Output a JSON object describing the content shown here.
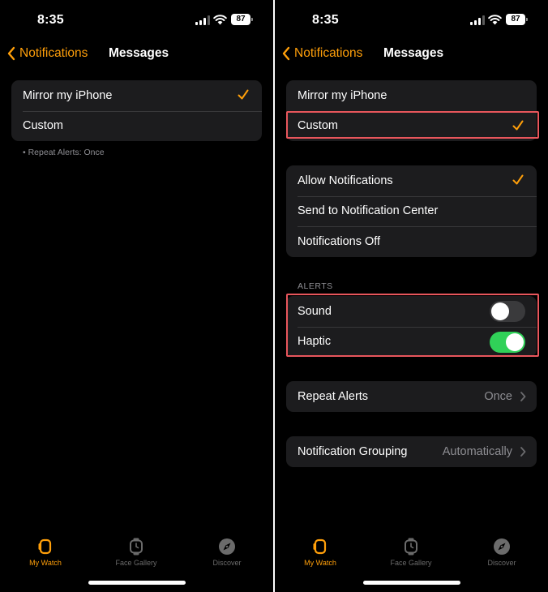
{
  "status_bar": {
    "time": "8:35",
    "battery": "87"
  },
  "nav": {
    "back_label": "Notifications",
    "title": "Messages"
  },
  "left": {
    "options": [
      {
        "label": "Mirror my iPhone",
        "selected": true
      },
      {
        "label": "Custom",
        "selected": false
      }
    ],
    "footnote": "• Repeat Alerts: Once"
  },
  "right": {
    "options": [
      {
        "label": "Mirror my iPhone",
        "selected": false
      },
      {
        "label": "Custom",
        "selected": true
      }
    ],
    "delivery": [
      {
        "label": "Allow Notifications",
        "selected": true
      },
      {
        "label": "Send to Notification Center",
        "selected": false
      },
      {
        "label": "Notifications Off",
        "selected": false
      }
    ],
    "alerts_header": "ALERTS",
    "alerts": [
      {
        "label": "Sound",
        "on": false
      },
      {
        "label": "Haptic",
        "on": true
      }
    ],
    "repeat_alerts": {
      "label": "Repeat Alerts",
      "value": "Once"
    },
    "grouping": {
      "label": "Notification Grouping",
      "value": "Automatically"
    }
  },
  "tab_bar": {
    "tabs": [
      {
        "label": "My Watch",
        "icon": "watch-icon",
        "active": true
      },
      {
        "label": "Face Gallery",
        "icon": "watch-face-icon",
        "active": false
      },
      {
        "label": "Discover",
        "icon": "compass-icon",
        "active": false
      }
    ]
  },
  "colors": {
    "accent": "#ff9f0a",
    "toggle_on": "#30d158",
    "highlight": "#e8565c",
    "background": "#000000",
    "cell": "#1c1c1e"
  }
}
